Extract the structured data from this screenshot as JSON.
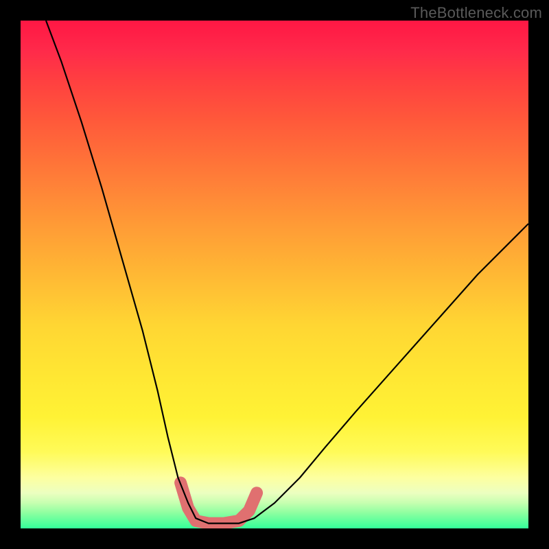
{
  "watermark": {
    "text": "TheBottleneck.com"
  },
  "chart_data": {
    "type": "line",
    "title": "",
    "xlabel": "",
    "ylabel": "",
    "xlim": [
      0,
      100
    ],
    "ylim": [
      0,
      100
    ],
    "grid": false,
    "legend": false,
    "gradient_stops": [
      {
        "pos": 0,
        "color": "#ff1744"
      },
      {
        "pos": 12,
        "color": "#ff4040"
      },
      {
        "pos": 30,
        "color": "#ff7a38"
      },
      {
        "pos": 50,
        "color": "#ffb834"
      },
      {
        "pos": 70,
        "color": "#ffe733"
      },
      {
        "pos": 90,
        "color": "#fdffa0"
      },
      {
        "pos": 97,
        "color": "#8cffa0"
      },
      {
        "pos": 100,
        "color": "#33ff99"
      }
    ],
    "series": [
      {
        "name": "bottleneck-curve",
        "color": "#000000",
        "width": 2,
        "x": [
          5,
          8,
          12,
          16,
          20,
          24,
          27,
          29,
          31,
          33,
          34.5,
          37,
          40,
          43,
          46,
          50,
          55,
          60,
          66,
          74,
          82,
          90,
          98,
          100
        ],
        "y": [
          100,
          92,
          80,
          67,
          53,
          39,
          27,
          18,
          10,
          5,
          2,
          1,
          1,
          1,
          2,
          5,
          10,
          16,
          23,
          32,
          41,
          50,
          58,
          60
        ]
      },
      {
        "name": "valley-highlight",
        "color": "#e07070",
        "width": 12,
        "linecap": "round",
        "x": [
          31.5,
          33,
          34.5,
          37,
          40,
          43,
          45,
          46.5
        ],
        "y": [
          9,
          4,
          1.5,
          1,
          1,
          1.5,
          3.5,
          7
        ]
      }
    ]
  }
}
